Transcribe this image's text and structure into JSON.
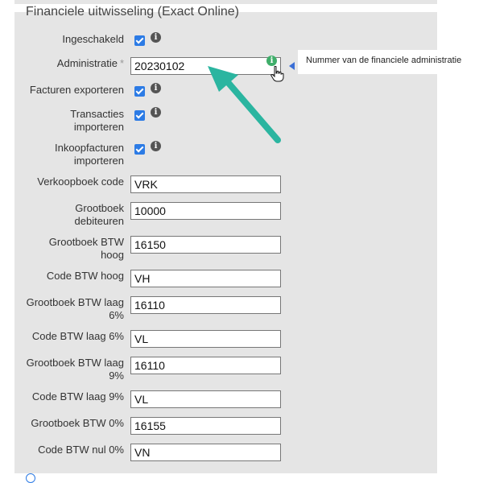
{
  "section": {
    "title": "Financiele uitwisseling (Exact Online)"
  },
  "fields": {
    "ingeschakeld": {
      "label": "Ingeschakeld",
      "checked": true
    },
    "administratie": {
      "label": "Administratie",
      "required_mark": "*",
      "value": "20230102"
    },
    "facturen_exporteren": {
      "label": "Facturen exporteren",
      "checked": true
    },
    "transacties_importeren": {
      "label_line1": "Transacties",
      "label_line2": "importeren",
      "checked": true
    },
    "inkoopfacturen_importeren": {
      "label_line1": "Inkoopfacturen",
      "label_line2": "importeren",
      "checked": true
    },
    "verkoopboek_code": {
      "label": "Verkoopboek code",
      "value": "VRK"
    },
    "grootboek_debiteuren": {
      "label_line1": "Grootboek",
      "label_line2": "debiteuren",
      "value": "10000"
    },
    "grootboek_btw_hoog": {
      "label_line1": "Grootboek BTW",
      "label_line2": "hoog",
      "value": "16150"
    },
    "code_btw_hoog": {
      "label": "Code BTW hoog",
      "value": "VH"
    },
    "grootboek_btw_laag_6": {
      "label_line1": "Grootboek BTW laag",
      "label_line2": "6%",
      "value": "16110"
    },
    "code_btw_laag_6": {
      "label": "Code BTW laag 6%",
      "value": "VL"
    },
    "grootboek_btw_laag_9": {
      "label_line1": "Grootboek BTW laag",
      "label_line2": "9%",
      "value": "16110"
    },
    "code_btw_laag_9": {
      "label": "Code BTW laag 9%",
      "value": "VL"
    },
    "grootboek_btw_0": {
      "label": "Grootboek BTW 0%",
      "value": "16155"
    },
    "code_btw_nul_0": {
      "label": "Code BTW nul 0%",
      "value": "VN"
    }
  },
  "tooltip": {
    "text": "Nummer van de financiele administratie"
  },
  "icons": {
    "info": "info-icon",
    "info_glyph": "i",
    "cursor": "hand-pointer-icon",
    "arrow": "annotation-arrow"
  },
  "colors": {
    "panel_bg": "#e5e5e5",
    "checkbox": "#2c7be5",
    "info_icon": "#555555",
    "info_icon_active": "#3fae6a",
    "annotation_arrow": "#2bb5a0",
    "tooltip_pointer": "#3b6fd6"
  }
}
